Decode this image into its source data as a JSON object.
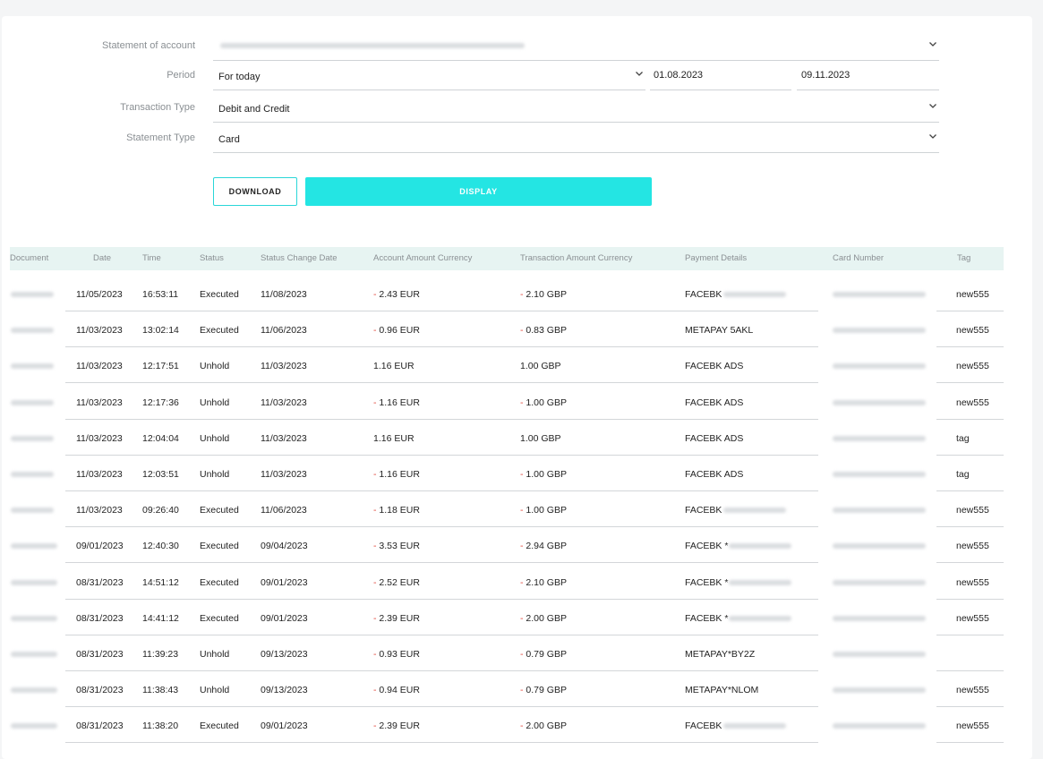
{
  "form": {
    "statement_of_account": {
      "label": "Statement of account",
      "value": ""
    },
    "period": {
      "label": "Period",
      "value": "For today",
      "date_from": "01.08.2023",
      "date_to": "09.11.2023"
    },
    "transaction_type": {
      "label": "Transaction Type",
      "value": "Debit and Credit"
    },
    "statement_type": {
      "label": "Statement Type",
      "value": "Card"
    }
  },
  "buttons": {
    "download": "DOWNLOAD",
    "display": "DISPLAY"
  },
  "colors": {
    "accent": "#24e5e3",
    "negative": "#e0453a",
    "header_bg": "#e7f4f2"
  },
  "table": {
    "columns": [
      "Document",
      "Date",
      "Time",
      "Status",
      "Status Change Date",
      "Account Amount Currency",
      "Transaction Amount Currency",
      "Payment Details",
      "Card Number",
      "Tag"
    ],
    "rows": [
      {
        "date": "11/05/2023",
        "time": "16:53:11",
        "status": "Executed",
        "status_change": "11/08/2023",
        "acc_sign": "-",
        "acc_amount": "2.43 EUR",
        "tx_sign": "-",
        "tx_amount": "2.10 GBP",
        "details": "FACEBK",
        "tag": "new555"
      },
      {
        "date": "11/03/2023",
        "time": "13:02:14",
        "status": "Executed",
        "status_change": "11/06/2023",
        "acc_sign": "-",
        "acc_amount": "0.96 EUR",
        "tx_sign": "-",
        "tx_amount": "0.83 GBP",
        "details": "METAPAY 5AKL",
        "tag": "new555"
      },
      {
        "date": "11/03/2023",
        "time": "12:17:51",
        "status": "Unhold",
        "status_change": "11/03/2023",
        "acc_sign": "",
        "acc_amount": "1.16 EUR",
        "tx_sign": "",
        "tx_amount": "1.00 GBP",
        "details": "FACEBK ADS",
        "tag": "new555"
      },
      {
        "date": "11/03/2023",
        "time": "12:17:36",
        "status": "Unhold",
        "status_change": "11/03/2023",
        "acc_sign": "-",
        "acc_amount": "1.16 EUR",
        "tx_sign": "-",
        "tx_amount": "1.00 GBP",
        "details": "FACEBK ADS",
        "tag": "new555"
      },
      {
        "date": "11/03/2023",
        "time": "12:04:04",
        "status": "Unhold",
        "status_change": "11/03/2023",
        "acc_sign": "",
        "acc_amount": "1.16 EUR",
        "tx_sign": "",
        "tx_amount": "1.00 GBP",
        "details": "FACEBK ADS",
        "tag": "tag"
      },
      {
        "date": "11/03/2023",
        "time": "12:03:51",
        "status": "Unhold",
        "status_change": "11/03/2023",
        "acc_sign": "-",
        "acc_amount": "1.16 EUR",
        "tx_sign": "-",
        "tx_amount": "1.00 GBP",
        "details": "FACEBK ADS",
        "tag": "tag"
      },
      {
        "date": "11/03/2023",
        "time": "09:26:40",
        "status": "Executed",
        "status_change": "11/06/2023",
        "acc_sign": "-",
        "acc_amount": "1.18 EUR",
        "tx_sign": "-",
        "tx_amount": "1.00 GBP",
        "details": "FACEBK",
        "tag": "new555"
      },
      {
        "date": "09/01/2023",
        "time": "12:40:30",
        "status": "Executed",
        "status_change": "09/04/2023",
        "acc_sign": "-",
        "acc_amount": "3.53 EUR",
        "tx_sign": "-",
        "tx_amount": "2.94 GBP",
        "details": "FACEBK *",
        "tag": "new555"
      },
      {
        "date": "08/31/2023",
        "time": "14:51:12",
        "status": "Executed",
        "status_change": "09/01/2023",
        "acc_sign": "-",
        "acc_amount": "2.52 EUR",
        "tx_sign": "-",
        "tx_amount": "2.10 GBP",
        "details": "FACEBK *",
        "tag": "new555"
      },
      {
        "date": "08/31/2023",
        "time": "14:41:12",
        "status": "Executed",
        "status_change": "09/01/2023",
        "acc_sign": "-",
        "acc_amount": "2.39 EUR",
        "tx_sign": "-",
        "tx_amount": "2.00 GBP",
        "details": "FACEBK *",
        "tag": "new555"
      },
      {
        "date": "08/31/2023",
        "time": "11:39:23",
        "status": "Unhold",
        "status_change": "09/13/2023",
        "acc_sign": "-",
        "acc_amount": "0.93 EUR",
        "tx_sign": "-",
        "tx_amount": "0.79 GBP",
        "details": "METAPAY*BY2Z",
        "tag": ""
      },
      {
        "date": "08/31/2023",
        "time": "11:38:43",
        "status": "Unhold",
        "status_change": "09/13/2023",
        "acc_sign": "-",
        "acc_amount": "0.94 EUR",
        "tx_sign": "-",
        "tx_amount": "0.79 GBP",
        "details": "METAPAY*NLOM",
        "tag": "new555"
      },
      {
        "date": "08/31/2023",
        "time": "11:38:20",
        "status": "Executed",
        "status_change": "09/01/2023",
        "acc_sign": "-",
        "acc_amount": "2.39 EUR",
        "tx_sign": "-",
        "tx_amount": "2.00 GBP",
        "details": "FACEBK",
        "tag": "new555"
      }
    ]
  }
}
